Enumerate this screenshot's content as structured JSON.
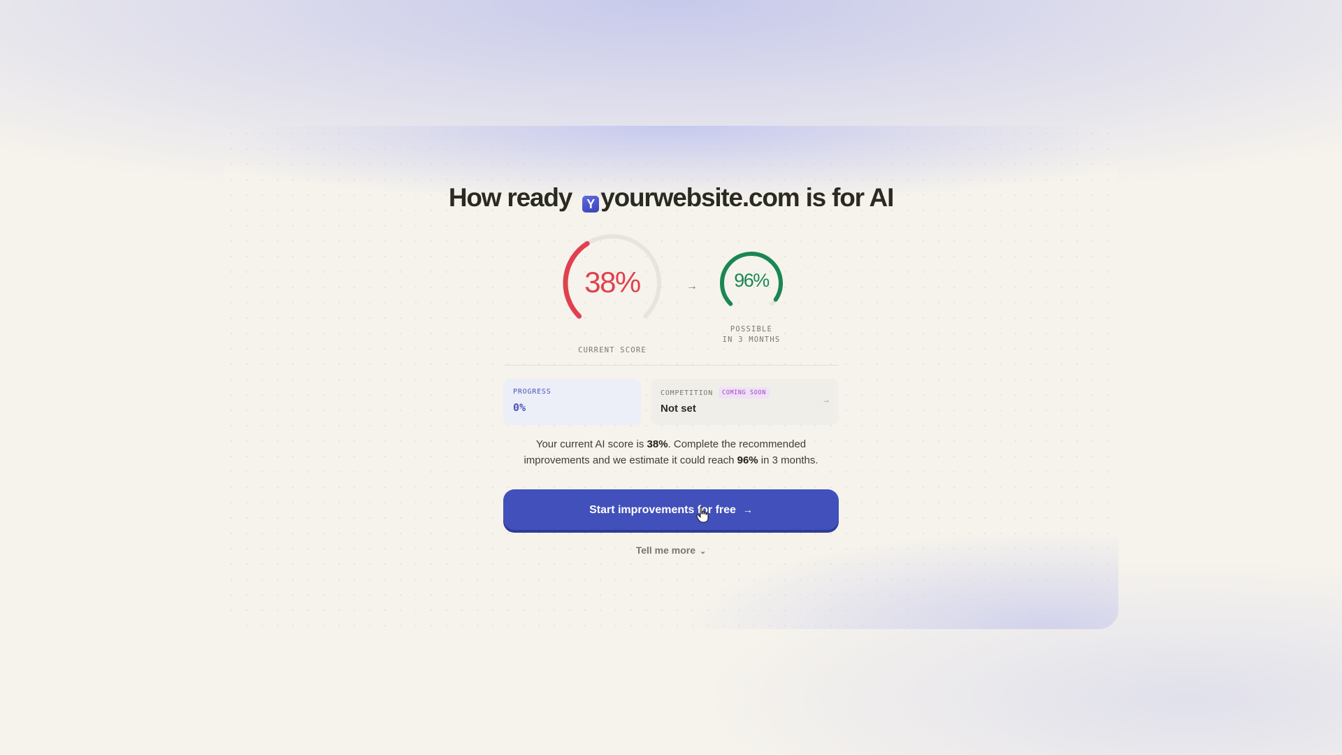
{
  "header": {
    "prefix": "How ready",
    "favicon_letter": "Y",
    "domain": "yourwebsite.com",
    "suffix": "is for AI"
  },
  "scores": {
    "current": {
      "value": 38,
      "display": "38%",
      "label": "CURRENT SCORE",
      "color": "#e0414f"
    },
    "possible": {
      "value": 96,
      "display": "96%",
      "label_line1": "POSSIBLE",
      "label_line2": "IN 3 MONTHS",
      "color": "#1a8752"
    },
    "arrow_icon": "arrow-right-icon"
  },
  "stats": {
    "progress": {
      "label": "PROGRESS",
      "value": "0%"
    },
    "competition": {
      "label": "COMPETITION",
      "badge": "COMING SOON",
      "value": "Not set"
    }
  },
  "summary": {
    "part1": "Your current AI score is ",
    "score": "38%",
    "part2": ". Complete the recommended improvements and we estimate it could reach ",
    "target": "96%",
    "part3": " in 3 months."
  },
  "cta": {
    "label": "Start improvements for free"
  },
  "tell_more": {
    "label": "Tell me more"
  },
  "colors": {
    "accent": "#4150ba",
    "bad": "#e0414f",
    "good": "#1a8752",
    "background": "#f6f3ec"
  }
}
